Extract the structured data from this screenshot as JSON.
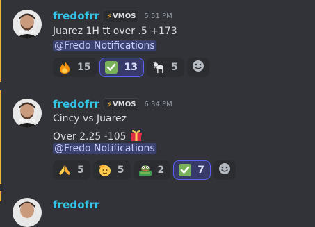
{
  "messages": [
    {
      "username": "fredofrr",
      "tag": "VMOS",
      "timestamp": "5:51 PM",
      "lines": [
        "Juarez 1H tt over .5 +173"
      ],
      "mention": "@Fredo Notifications",
      "reactions": [
        {
          "emoji": "fire-emoji",
          "count": "15",
          "me": false
        },
        {
          "emoji": "check-mark-emoji",
          "count": "13",
          "me": true
        },
        {
          "emoji": "goat-emoji",
          "count": "5",
          "me": false
        }
      ]
    },
    {
      "username": "fredofrr",
      "tag": "VMOS",
      "timestamp": "6:34 PM",
      "lines": [
        "Cincy vs Juarez",
        "Over 2.25 -105"
      ],
      "mention": "@Fredo Notifications",
      "reactions": [
        {
          "emoji": "praying-hands-emoji",
          "count": "5",
          "me": false
        },
        {
          "emoji": "saluting-face-emoji",
          "count": "5",
          "me": false
        },
        {
          "emoji": "frog-money-emoji",
          "count": "2",
          "me": false
        },
        {
          "emoji": "check-mark-emoji",
          "count": "7",
          "me": true
        }
      ]
    }
  ],
  "colors": {
    "background": "#313338",
    "username": "#35c5ea",
    "mention_bar": "#f0b232",
    "mention_bg": "#3c4270",
    "mention_text": "#c9cdfb",
    "reaction_me_border": "#5865f2"
  }
}
